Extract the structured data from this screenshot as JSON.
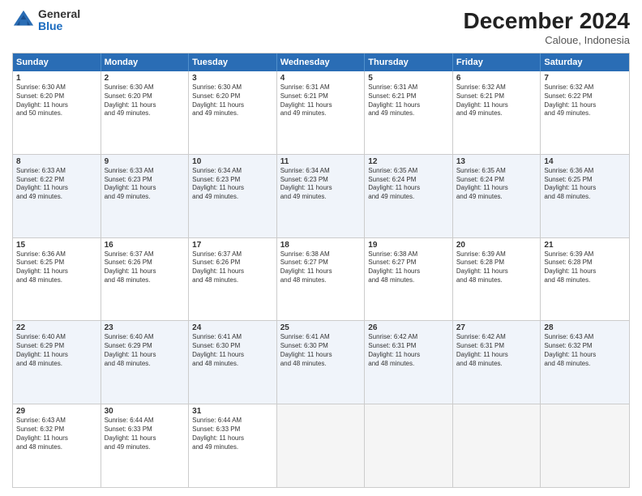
{
  "header": {
    "logo_general": "General",
    "logo_blue": "Blue",
    "month_title": "December 2024",
    "location": "Caloue, Indonesia"
  },
  "weekdays": [
    "Sunday",
    "Monday",
    "Tuesday",
    "Wednesday",
    "Thursday",
    "Friday",
    "Saturday"
  ],
  "rows": [
    [
      {
        "day": "1",
        "info": "Sunrise: 6:30 AM\nSunset: 6:20 PM\nDaylight: 11 hours\nand 50 minutes."
      },
      {
        "day": "2",
        "info": "Sunrise: 6:30 AM\nSunset: 6:20 PM\nDaylight: 11 hours\nand 49 minutes."
      },
      {
        "day": "3",
        "info": "Sunrise: 6:30 AM\nSunset: 6:20 PM\nDaylight: 11 hours\nand 49 minutes."
      },
      {
        "day": "4",
        "info": "Sunrise: 6:31 AM\nSunset: 6:21 PM\nDaylight: 11 hours\nand 49 minutes."
      },
      {
        "day": "5",
        "info": "Sunrise: 6:31 AM\nSunset: 6:21 PM\nDaylight: 11 hours\nand 49 minutes."
      },
      {
        "day": "6",
        "info": "Sunrise: 6:32 AM\nSunset: 6:21 PM\nDaylight: 11 hours\nand 49 minutes."
      },
      {
        "day": "7",
        "info": "Sunrise: 6:32 AM\nSunset: 6:22 PM\nDaylight: 11 hours\nand 49 minutes."
      }
    ],
    [
      {
        "day": "8",
        "info": "Sunrise: 6:33 AM\nSunset: 6:22 PM\nDaylight: 11 hours\nand 49 minutes."
      },
      {
        "day": "9",
        "info": "Sunrise: 6:33 AM\nSunset: 6:23 PM\nDaylight: 11 hours\nand 49 minutes."
      },
      {
        "day": "10",
        "info": "Sunrise: 6:34 AM\nSunset: 6:23 PM\nDaylight: 11 hours\nand 49 minutes."
      },
      {
        "day": "11",
        "info": "Sunrise: 6:34 AM\nSunset: 6:23 PM\nDaylight: 11 hours\nand 49 minutes."
      },
      {
        "day": "12",
        "info": "Sunrise: 6:35 AM\nSunset: 6:24 PM\nDaylight: 11 hours\nand 49 minutes."
      },
      {
        "day": "13",
        "info": "Sunrise: 6:35 AM\nSunset: 6:24 PM\nDaylight: 11 hours\nand 49 minutes."
      },
      {
        "day": "14",
        "info": "Sunrise: 6:36 AM\nSunset: 6:25 PM\nDaylight: 11 hours\nand 48 minutes."
      }
    ],
    [
      {
        "day": "15",
        "info": "Sunrise: 6:36 AM\nSunset: 6:25 PM\nDaylight: 11 hours\nand 48 minutes."
      },
      {
        "day": "16",
        "info": "Sunrise: 6:37 AM\nSunset: 6:26 PM\nDaylight: 11 hours\nand 48 minutes."
      },
      {
        "day": "17",
        "info": "Sunrise: 6:37 AM\nSunset: 6:26 PM\nDaylight: 11 hours\nand 48 minutes."
      },
      {
        "day": "18",
        "info": "Sunrise: 6:38 AM\nSunset: 6:27 PM\nDaylight: 11 hours\nand 48 minutes."
      },
      {
        "day": "19",
        "info": "Sunrise: 6:38 AM\nSunset: 6:27 PM\nDaylight: 11 hours\nand 48 minutes."
      },
      {
        "day": "20",
        "info": "Sunrise: 6:39 AM\nSunset: 6:28 PM\nDaylight: 11 hours\nand 48 minutes."
      },
      {
        "day": "21",
        "info": "Sunrise: 6:39 AM\nSunset: 6:28 PM\nDaylight: 11 hours\nand 48 minutes."
      }
    ],
    [
      {
        "day": "22",
        "info": "Sunrise: 6:40 AM\nSunset: 6:29 PM\nDaylight: 11 hours\nand 48 minutes."
      },
      {
        "day": "23",
        "info": "Sunrise: 6:40 AM\nSunset: 6:29 PM\nDaylight: 11 hours\nand 48 minutes."
      },
      {
        "day": "24",
        "info": "Sunrise: 6:41 AM\nSunset: 6:30 PM\nDaylight: 11 hours\nand 48 minutes."
      },
      {
        "day": "25",
        "info": "Sunrise: 6:41 AM\nSunset: 6:30 PM\nDaylight: 11 hours\nand 48 minutes."
      },
      {
        "day": "26",
        "info": "Sunrise: 6:42 AM\nSunset: 6:31 PM\nDaylight: 11 hours\nand 48 minutes."
      },
      {
        "day": "27",
        "info": "Sunrise: 6:42 AM\nSunset: 6:31 PM\nDaylight: 11 hours\nand 48 minutes."
      },
      {
        "day": "28",
        "info": "Sunrise: 6:43 AM\nSunset: 6:32 PM\nDaylight: 11 hours\nand 48 minutes."
      }
    ],
    [
      {
        "day": "29",
        "info": "Sunrise: 6:43 AM\nSunset: 6:32 PM\nDaylight: 11 hours\nand 48 minutes."
      },
      {
        "day": "30",
        "info": "Sunrise: 6:44 AM\nSunset: 6:33 PM\nDaylight: 11 hours\nand 49 minutes."
      },
      {
        "day": "31",
        "info": "Sunrise: 6:44 AM\nSunset: 6:33 PM\nDaylight: 11 hours\nand 49 minutes."
      },
      {
        "day": "",
        "info": ""
      },
      {
        "day": "",
        "info": ""
      },
      {
        "day": "",
        "info": ""
      },
      {
        "day": "",
        "info": ""
      }
    ]
  ]
}
